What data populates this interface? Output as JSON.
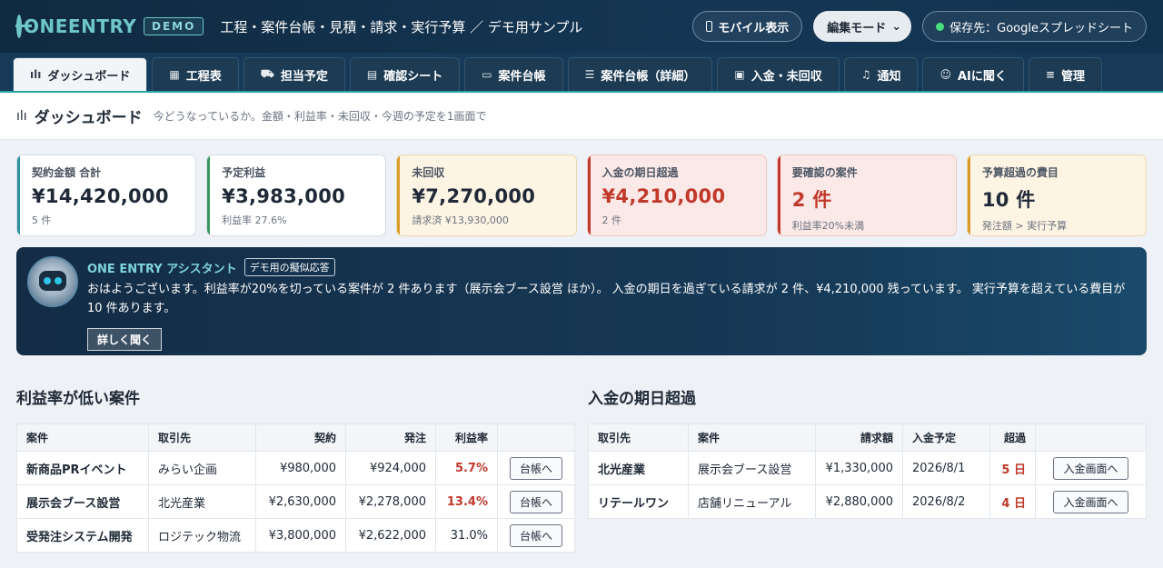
{
  "header": {
    "logo_text": "ONEENTRY",
    "demo_badge": "DEMO",
    "title": "工程・案件台帳・見積・請求・実行予算 ／ デモ用サンプル",
    "mobile_button": "モバイル表示",
    "mode_select": "編集モード",
    "storage_status": "保存先：Googleスプレッドシート",
    "status_color": "#4ade80"
  },
  "tabs": [
    {
      "label": "ダッシュボード",
      "icon": "chart-icon",
      "glyph": "ılı",
      "active": true
    },
    {
      "label": "工程表",
      "icon": "calendar-icon",
      "glyph": "▦"
    },
    {
      "label": "担当予定",
      "icon": "truck-icon",
      "glyph": "⛟"
    },
    {
      "label": "確認シート",
      "icon": "clipboard-icon",
      "glyph": "▤"
    },
    {
      "label": "案件台帳",
      "icon": "folder-icon",
      "glyph": "▭"
    },
    {
      "label": "案件台帳（詳細）",
      "icon": "list-icon",
      "glyph": "☰"
    },
    {
      "label": "入金・未回収",
      "icon": "money-icon",
      "glyph": "▣"
    },
    {
      "label": "通知",
      "icon": "bell-icon",
      "glyph": "♫"
    },
    {
      "label": "AIに聞く",
      "icon": "robot-icon",
      "glyph": "☺"
    },
    {
      "label": "管理",
      "icon": "sliders-icon",
      "glyph": "≡"
    }
  ],
  "page": {
    "title": "ダッシュボード",
    "subtitle": "今どうなっているか。金額・利益率・未回収・今週の予定を1画面で"
  },
  "kpis": [
    {
      "label": "契約金額 合計",
      "value": "¥14,420,000",
      "sub": "5 件",
      "tone": "teal"
    },
    {
      "label": "予定利益",
      "value": "¥3,983,000",
      "sub": "利益率 27.6%",
      "tone": "green"
    },
    {
      "label": "未回収",
      "value": "¥7,270,000",
      "sub": "請求済 ¥13,930,000",
      "tone": "amber"
    },
    {
      "label": "入金の期日超過",
      "value": "¥4,210,000",
      "sub": "2 件",
      "tone": "red"
    },
    {
      "label": "要確認の案件",
      "value": "2 件",
      "sub": "利益率20%未満",
      "tone": "red"
    },
    {
      "label": "予算超過の費目",
      "value": "10 件",
      "sub": "発注額 > 実行予算",
      "tone": "amber"
    }
  ],
  "assistant": {
    "name": "ONE ENTRY アシスタント",
    "tag": "デモ用の擬似応答",
    "message": "おはようございます。利益率が20%を切っている案件が 2 件あります（展示会ブース設営 ほか）。 入金の期日を過ぎている請求が 2 件、¥4,210,000 残っています。 実行予算を超えている費目が 10 件あります。",
    "button": "詳しく聞く"
  },
  "low_margin": {
    "title": "利益率が低い案件",
    "headers": [
      "案件",
      "取引先",
      "契約",
      "発注",
      "利益率",
      ""
    ],
    "rows": [
      {
        "project": "新商品PRイベント",
        "client": "みらい企画",
        "contract": "¥980,000",
        "order": "¥924,000",
        "margin": "5.7%",
        "warn": true,
        "action": "台帳へ"
      },
      {
        "project": "展示会ブース設営",
        "client": "北光産業",
        "contract": "¥2,630,000",
        "order": "¥2,278,000",
        "margin": "13.4%",
        "warn": true,
        "action": "台帳へ"
      },
      {
        "project": "受発注システム開発",
        "client": "ロジテック物流",
        "contract": "¥3,800,000",
        "order": "¥2,622,000",
        "margin": "31.0%",
        "warn": false,
        "action": "台帳へ"
      }
    ]
  },
  "overdue": {
    "title": "入金の期日超過",
    "headers": [
      "取引先",
      "案件",
      "請求額",
      "入金予定",
      "超過",
      ""
    ],
    "rows": [
      {
        "client": "北光産業",
        "project": "展示会ブース設営",
        "amount": "¥1,330,000",
        "due": "2026/8/1",
        "over": "5 日",
        "action": "入金画面へ"
      },
      {
        "client": "リテールワン",
        "project": "店舗リニューアル",
        "amount": "¥2,880,000",
        "due": "2026/8/2",
        "over": "4 日",
        "action": "入金画面へ"
      }
    ]
  }
}
